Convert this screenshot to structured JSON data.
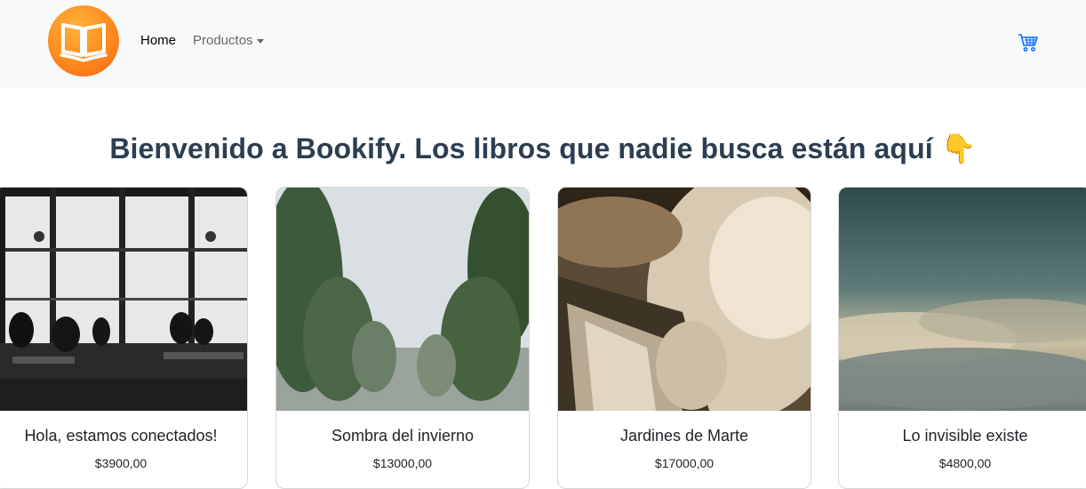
{
  "nav": {
    "home_label": "Home",
    "products_label": "Productos",
    "logo_icon": "open-book-icon",
    "cart_icon": "shopping-cart-icon"
  },
  "hero": {
    "headline": "Bienvenido a Bookify. Los libros que nadie busca están aquí 👇"
  },
  "products": [
    {
      "title": "Hola, estamos conectados!",
      "price": "$3900,00",
      "image": "cafe-silhouettes-photo"
    },
    {
      "title": "Sombra del invierno",
      "price": "$13000,00",
      "image": "misty-trees-photo"
    },
    {
      "title": "Jardines de Marte",
      "price": "$17000,00",
      "image": "steamy-waterfall-photo"
    },
    {
      "title": "Lo invisible existe",
      "price": "$4800,00",
      "image": "cloudy-sky-photo"
    }
  ],
  "colors": {
    "navbar_bg": "#f8f9fa",
    "logo_orange": "#ff8a1c",
    "cart_blue": "#0d6efd",
    "headline": "#2c3e50"
  }
}
